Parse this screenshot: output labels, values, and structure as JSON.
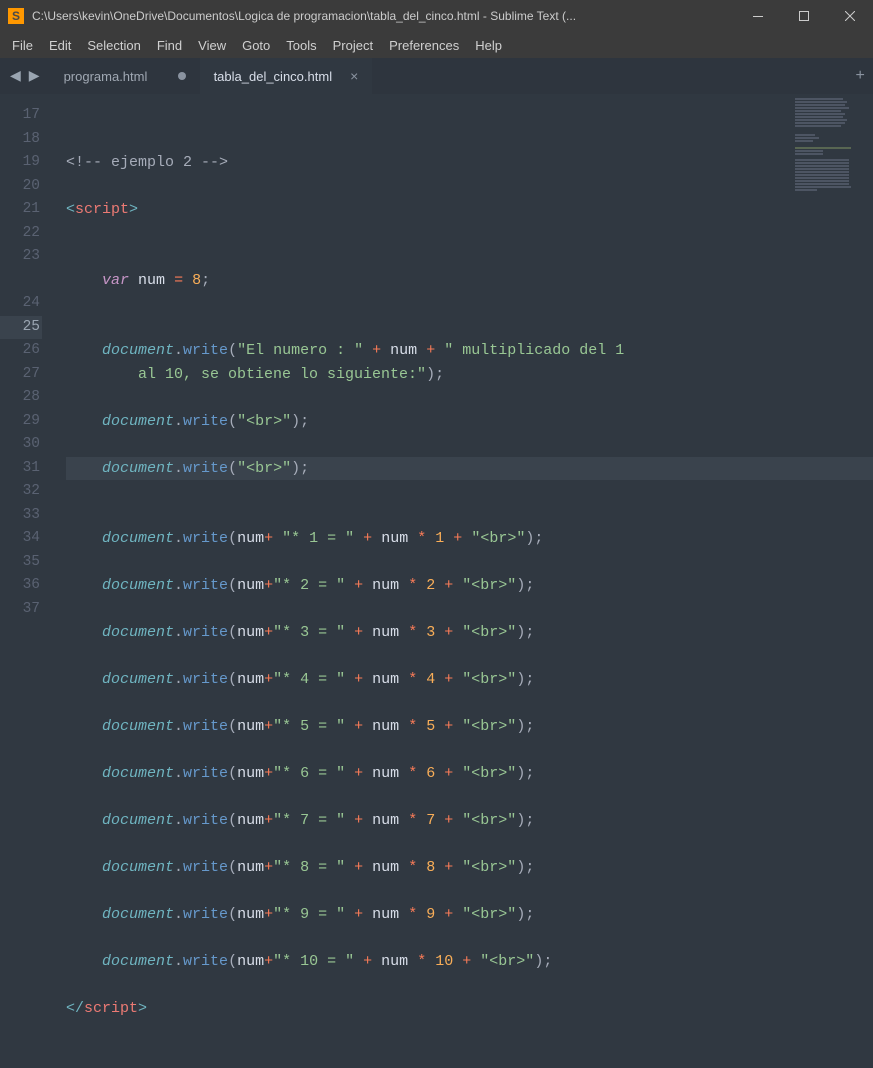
{
  "titlebar": {
    "title": "C:\\Users\\kevin\\OneDrive\\Documentos\\Logica de programacion\\tabla_del_cinco.html - Sublime Text (..."
  },
  "menu": {
    "file": "File",
    "edit": "Edit",
    "selection": "Selection",
    "find": "Find",
    "view": "View",
    "goto": "Goto",
    "tools": "Tools",
    "project": "Project",
    "preferences": "Preferences",
    "help": "Help"
  },
  "tabs": {
    "t0": "programa.html",
    "t1": "tabla_del_cinco.html"
  },
  "gutter": {
    "start": 17,
    "end": 37,
    "highlighted": 25
  },
  "code": {
    "comment": "<!-- ejemplo 2 -->",
    "script_tag": "script",
    "var_kw": "var",
    "num_name": "num",
    "eq": "=",
    "eight": "8",
    "semi": ";",
    "doc": "document",
    "write": "write",
    "str_elnumero": "\"El numero : \"",
    "plus": "+",
    "str_mult": "\" multiplicado del 1",
    "str_al10": "al 10, se obtiene lo siguiente:\"",
    "str_br": "\"<br>\"",
    "star": "*",
    "l1a": "\"* 1 = \"",
    "n1": "1",
    "l2a": "\"* 2 = \"",
    "n2": "2",
    "l3a": "\"* 3 = \"",
    "n3": "3",
    "l4a": "\"* 4 = \"",
    "n4": "4",
    "l5a": "\"* 5 = \"",
    "n5": "5",
    "l6a": "\"* 6 = \"",
    "n6": "6",
    "l7a": "\"* 7 = \"",
    "n7": "7",
    "l8a": "\"* 8 = \"",
    "n8": "8",
    "l9a": "\"* 9 = \"",
    "n9": "9",
    "l10a": "\"* 10 = \"",
    "n10": "10"
  }
}
